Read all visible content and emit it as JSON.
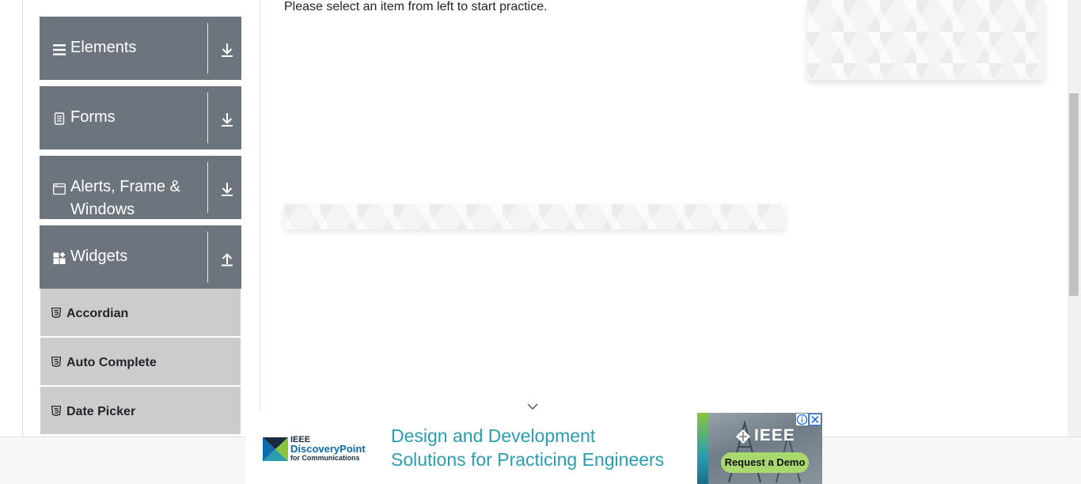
{
  "instruction": "Please select an item from left to start practice.",
  "groups": [
    {
      "label": "Elements",
      "icon": "menu-bars-icon",
      "state": "collapsed"
    },
    {
      "label": "Forms",
      "icon": "document-icon",
      "state": "collapsed"
    },
    {
      "label": "Alerts, Frame & Windows",
      "icon": "browser-window-icon",
      "state": "collapsed"
    },
    {
      "label": "Widgets",
      "icon": "widgets-grid-icon",
      "state": "expanded"
    }
  ],
  "menu_items": [
    {
      "label": "Accordian",
      "icon": "html5-icon"
    },
    {
      "label": "Auto Complete",
      "icon": "html5-icon"
    },
    {
      "label": "Date Picker",
      "icon": "html5-icon"
    }
  ],
  "ad": {
    "brand_top": "IEEE",
    "brand_main": "DiscoveryPoint",
    "brand_sub": "for Communications",
    "headline_line1": "Design and Development",
    "headline_line2": "Solutions for Practicing Engineers",
    "badge": "IEEE",
    "cta": "Request a Demo",
    "colors": {
      "headline": "#2a9eb0",
      "cta": "#a8d86e",
      "close": "#1a73e8"
    }
  },
  "colors": {
    "group_bg": "#6c757d",
    "menu_item_bg": "#cccccc",
    "text": "#212529"
  }
}
